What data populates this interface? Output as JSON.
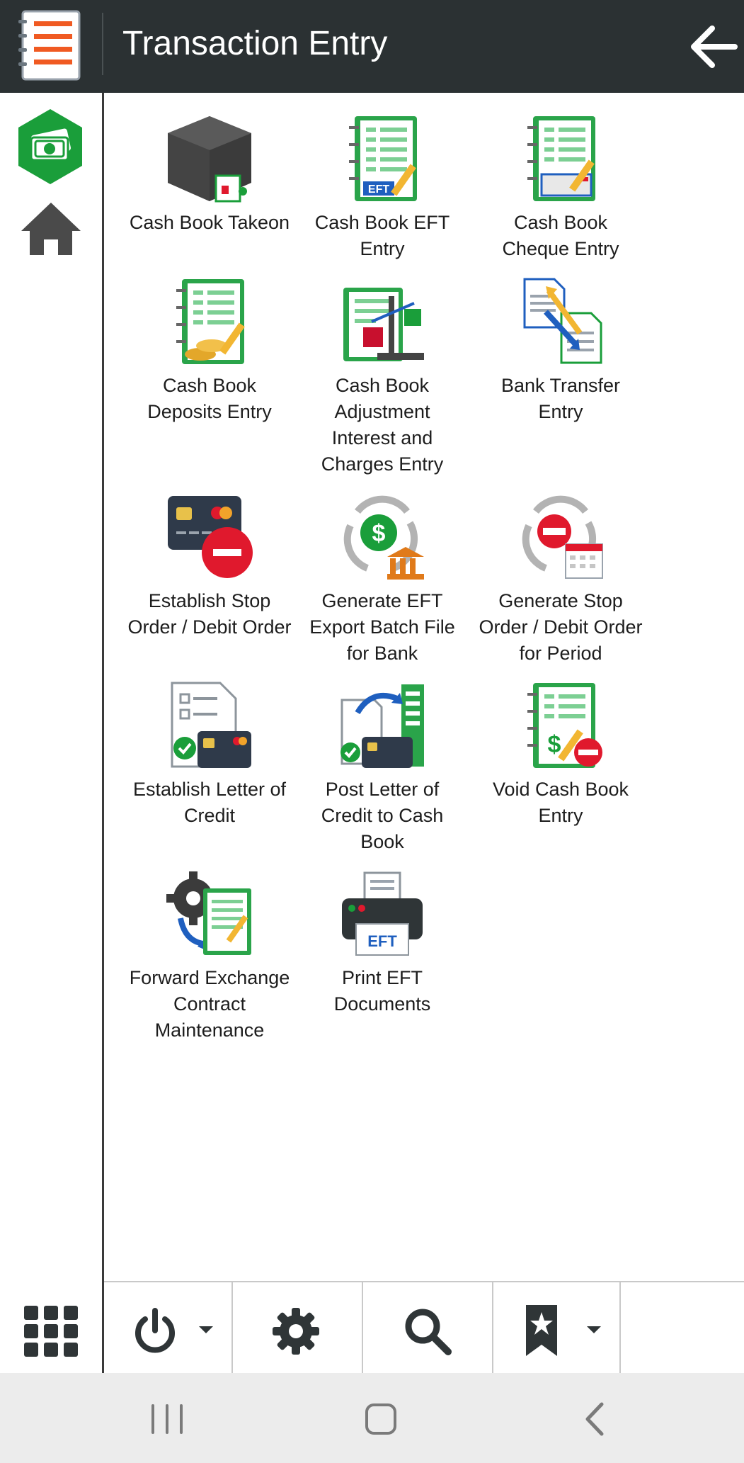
{
  "header": {
    "title": "Transaction Entry"
  },
  "tiles": [
    {
      "label": "Cash Book Takeon"
    },
    {
      "label": "Cash Book EFT Entry"
    },
    {
      "label": "Cash Book Cheque Entry"
    },
    {
      "label": "Cash Book Deposits Entry"
    },
    {
      "label": "Cash Book Adjustment Interest and Charges Entry"
    },
    {
      "label": "Bank Transfer Entry"
    },
    {
      "label": "Establish Stop Order / Debit Order"
    },
    {
      "label": "Generate EFT Export Batch File for Bank"
    },
    {
      "label": "Generate Stop Order / Debit Order for Period"
    },
    {
      "label": "Establish Letter of Credit"
    },
    {
      "label": "Post Letter of Credit to Cash Book"
    },
    {
      "label": "Void Cash Book Entry"
    },
    {
      "label": "Forward Exchange Contract Maintenance"
    },
    {
      "label": "Print EFT Documents"
    }
  ],
  "icon_text": {
    "eft": "EFT",
    "dollar": "$"
  },
  "colors": {
    "header_bg": "#2b3133",
    "accent_green": "#1a9e3a",
    "book_green": "#2aa44a",
    "stop_red": "#e0192d",
    "arrow_blue": "#1f5fbf",
    "icon_dark": "#2f3537"
  }
}
